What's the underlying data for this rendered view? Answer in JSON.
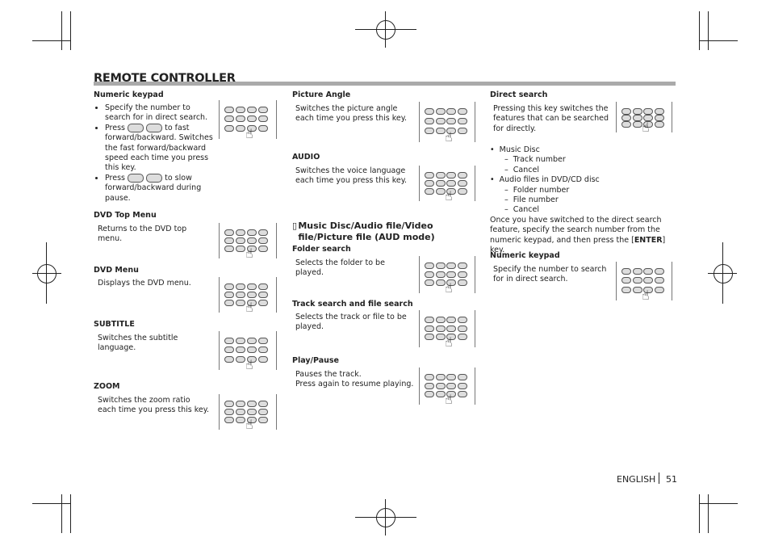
{
  "title": "REMOTE CONTROLLER",
  "left": {
    "numeric_keypad": {
      "heading": "Numeric keypad",
      "bullets": [
        "Specify the number to search for in direct search.",
        "Press",
        "to fast forward/backward. Switches the fast forward/backward speed each time you press this key.",
        "Press",
        "to slow forward/backward during pause."
      ]
    },
    "dvd_top_menu": {
      "heading": "DVD Top Menu",
      "text": "Returns to the DVD top menu."
    },
    "dvd_menu": {
      "heading": "DVD Menu",
      "text": "Displays the DVD menu."
    },
    "subtitle": {
      "heading": "SUBTITLE",
      "text": "Switches the subtitle language."
    },
    "zoom": {
      "heading": "ZOOM",
      "text": "Switches the zoom ratio each time you press this key."
    }
  },
  "middle": {
    "picture_angle": {
      "heading": "Picture Angle",
      "text": "Switches the picture angle each time you press this key."
    },
    "audio": {
      "heading": "AUDIO",
      "text": "Switches the voice language each time you press this key."
    },
    "section": {
      "icon": "▯",
      "heading": "Music Disc/Audio file/Video file/Picture file (AUD mode)"
    },
    "folder_search": {
      "heading": "Folder search",
      "text": "Selects the folder to be played."
    },
    "track_search": {
      "heading": "Track search and file search",
      "text": "Selects the track or file to be played."
    },
    "play_pause": {
      "heading": "Play/Pause",
      "line1": "Pauses the track.",
      "line2": "Press again to resume playing."
    }
  },
  "right": {
    "direct_search": {
      "heading": "Direct search",
      "text": "Pressing this key switches the features that can be searched for directly.",
      "list": [
        {
          "bullet": "Music Disc",
          "sub": [
            "Track number",
            "Cancel"
          ]
        },
        {
          "bullet": "Audio files in DVD/CD disc",
          "sub": [
            "Folder number",
            "File number",
            "Cancel"
          ]
        }
      ],
      "after_pre": "Once you have switched to the direct search feature, specify the search number from the numeric keypad, and then press the [",
      "after_key": "ENTER",
      "after_post": "] key."
    },
    "numeric_keypad": {
      "heading": "Numeric keypad",
      "text": "Specify the number to search for in direct search."
    }
  },
  "footer": {
    "language": "ENGLISH",
    "page": "51"
  }
}
